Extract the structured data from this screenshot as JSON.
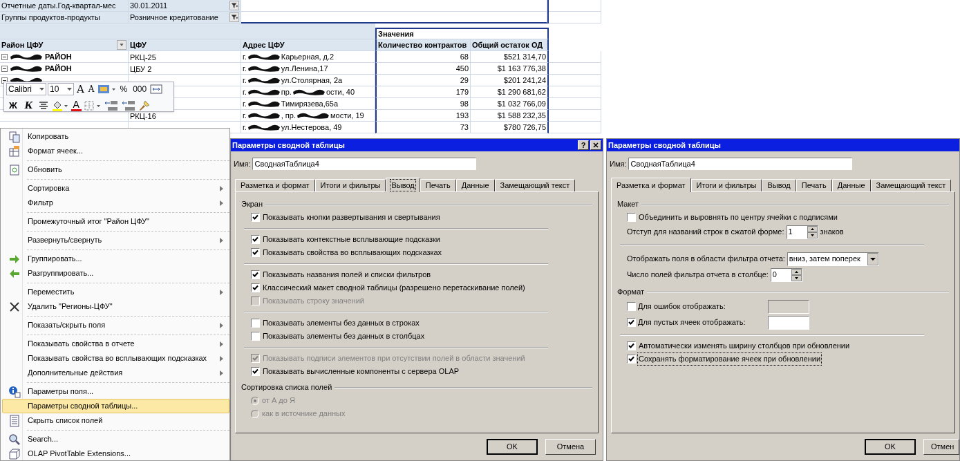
{
  "sheet": {
    "filters": [
      {
        "label": "Отчетные даты.Год-квартал-мес",
        "value": "30.01.2011"
      },
      {
        "label": "Группы продуктов-продукты",
        "value": "Розничное кредитование"
      }
    ],
    "values_header": "Значения",
    "columns": [
      "Район ЦФУ",
      "ЦФУ",
      "Адрес ЦФУ",
      "Количество контрактов",
      "Общий остаток ОД"
    ],
    "rows": [
      {
        "region": [
          {
            "kind": "redaction"
          },
          {
            "kind": "text",
            "text": "РАЙОН"
          }
        ],
        "cfu": "РКЦ-25",
        "address": [
          {
            "kind": "text",
            "text": "г."
          },
          {
            "kind": "redaction"
          },
          {
            "kind": "text",
            "text": "Карьерная, д.2"
          }
        ],
        "count": "68",
        "balance": "$521 314,70"
      },
      {
        "region": [
          {
            "kind": "redaction"
          },
          {
            "kind": "text",
            "text": "РАЙОН"
          }
        ],
        "cfu": "ЦБУ 2",
        "address": [
          {
            "kind": "text",
            "text": "г."
          },
          {
            "kind": "redaction"
          },
          {
            "kind": "text",
            "text": "ул.Ленина,17"
          }
        ],
        "count": "450",
        "balance": "$1 163 776,38"
      },
      {
        "region": [
          {
            "kind": "redaction"
          }
        ],
        "cfu": "",
        "address": [
          {
            "kind": "text",
            "text": "г."
          },
          {
            "kind": "redaction"
          },
          {
            "kind": "text",
            "text": "ул.Столярная, 2а"
          }
        ],
        "count": "29",
        "balance": "$201 241,24"
      },
      {
        "region": [],
        "cfu": "",
        "address": [
          {
            "kind": "text",
            "text": "г."
          },
          {
            "kind": "redaction"
          },
          {
            "kind": "text",
            "text": "пр."
          },
          {
            "kind": "redaction"
          },
          {
            "kind": "text",
            "text": "ости, 40"
          }
        ],
        "count": "179",
        "balance": "$1 290 681,62"
      },
      {
        "region": [],
        "cfu": "",
        "address": [
          {
            "kind": "text",
            "text": "г."
          },
          {
            "kind": "redaction"
          },
          {
            "kind": "text",
            "text": "Тимирязева,65а"
          }
        ],
        "count": "98",
        "balance": "$1 032 766,09"
      },
      {
        "region": [],
        "cfu": "РКЦ-16",
        "address": [
          {
            "kind": "text",
            "text": "г."
          },
          {
            "kind": "redaction"
          },
          {
            "kind": "text",
            "text": ", пр."
          },
          {
            "kind": "redaction"
          },
          {
            "kind": "text",
            "text": "мости, 19"
          }
        ],
        "count": "193",
        "balance": "$1 588 232,35"
      },
      {
        "region": [],
        "cfu": "",
        "address": [
          {
            "kind": "text",
            "text": "г."
          },
          {
            "kind": "redaction"
          },
          {
            "kind": "text",
            "text": "ул.Нестерова, 49"
          }
        ],
        "count": "73",
        "balance": "$780 726,75"
      }
    ]
  },
  "mini_toolbar": {
    "font": "Calibri",
    "size": "10",
    "row1": [
      {
        "kind": "grow",
        "label": "A"
      },
      {
        "kind": "shrink",
        "label": "A"
      },
      {
        "kind": "styles"
      },
      {
        "kind": "percent",
        "label": "%"
      },
      {
        "kind": "thousands",
        "label": "000"
      },
      {
        "kind": "merge"
      }
    ],
    "row2": [
      {
        "kind": "bold",
        "label": "Ж"
      },
      {
        "kind": "italic",
        "label": "К"
      },
      {
        "kind": "center"
      },
      {
        "kind": "fill"
      },
      {
        "kind": "fontcolor",
        "label": "A"
      },
      {
        "kind": "borders"
      },
      {
        "kind": "inc"
      },
      {
        "kind": "dec"
      },
      {
        "kind": "painter"
      }
    ]
  },
  "context_menu": {
    "groups": [
      [
        {
          "label": "Копировать",
          "kind": "copy",
          "submenu": false,
          "selected": false
        },
        {
          "label": "Формат ячеек...",
          "kind": "format",
          "submenu": false,
          "selected": false
        }
      ],
      [
        {
          "label": "Обновить",
          "kind": "refresh",
          "submenu": false,
          "selected": false
        }
      ],
      [
        {
          "label": "Сортировка",
          "kind": "plain",
          "submenu": true,
          "selected": false
        },
        {
          "label": "Фильтр",
          "kind": "plain",
          "submenu": true,
          "selected": false
        }
      ],
      [
        {
          "label": "Промежуточный итог \"Район ЦФУ\"",
          "kind": "plain",
          "submenu": false,
          "selected": false
        }
      ],
      [
        {
          "label": "Развернуть/свернуть",
          "kind": "plain",
          "submenu": true,
          "selected": false
        }
      ],
      [
        {
          "label": "Группировать...",
          "kind": "group",
          "submenu": false,
          "selected": false
        },
        {
          "label": "Разгруппировать...",
          "kind": "ungroup",
          "submenu": false,
          "selected": false
        }
      ],
      [
        {
          "label": "Переместить",
          "kind": "plain",
          "submenu": true,
          "selected": false
        },
        {
          "label": "Удалить \"Регионы-ЦФУ\"",
          "kind": "delete",
          "submenu": false,
          "selected": false
        }
      ],
      [
        {
          "label": "Показать/скрыть поля",
          "kind": "plain",
          "submenu": true,
          "selected": false
        }
      ],
      [
        {
          "label": "Показывать свойства в отчете",
          "kind": "plain",
          "submenu": true,
          "selected": false
        },
        {
          "label": "Показывать свойства во всплывающих подсказках",
          "kind": "plain",
          "submenu": true,
          "selected": false
        },
        {
          "label": "Дополнительные действия",
          "kind": "plain",
          "submenu": true,
          "selected": false
        }
      ],
      [
        {
          "label": "Параметры поля...",
          "kind": "info",
          "submenu": false,
          "selected": false
        },
        {
          "label": "Параметры сводной таблицы...",
          "kind": "plain",
          "submenu": false,
          "selected": true
        },
        {
          "label": "Скрыть список полей",
          "kind": "list",
          "submenu": false,
          "selected": false
        }
      ],
      [
        {
          "label": "Search...",
          "kind": "search",
          "submenu": false,
          "selected": false
        },
        {
          "label": "OLAP PivotTable Extensions...",
          "kind": "cube",
          "submenu": false,
          "selected": false
        }
      ]
    ]
  },
  "dialogs": [
    {
      "title": "Параметры сводной таблицы",
      "help": "?",
      "name_label": "Имя:",
      "name": "СводнаяТаблица4",
      "tabs": [
        {
          "label": "Разметка и формат",
          "selected": false
        },
        {
          "label": "Итоги и фильтры",
          "selected": false
        },
        {
          "label": "Вывод",
          "selected": true
        },
        {
          "label": "Печать",
          "selected": false
        },
        {
          "label": "Данные",
          "selected": false
        },
        {
          "label": "Замещающий текст",
          "selected": false
        }
      ],
      "rows": [
        {
          "kind": "section",
          "label": "Экран"
        },
        {
          "kind": "checkbox",
          "label": "Показывать кнопки развертывания и свертывания",
          "checked": true,
          "disabled": false
        },
        {
          "kind": "divider"
        },
        {
          "kind": "checkbox",
          "label": "Показывать контекстные всплывающие подсказки",
          "checked": true,
          "disabled": false
        },
        {
          "kind": "checkbox",
          "label": "Показывать свойства во всплывающих подсказках",
          "checked": true,
          "disabled": false
        },
        {
          "kind": "divider"
        },
        {
          "kind": "checkbox",
          "label": "Показывать названия полей и списки фильтров",
          "checked": true,
          "disabled": false
        },
        {
          "kind": "checkbox",
          "label": "Классический макет сводной таблицы (разрешено перетаскивание полей)",
          "checked": true,
          "disabled": false
        },
        {
          "kind": "checkbox",
          "label": "Показывать строку значений",
          "checked": false,
          "disabled": true
        },
        {
          "kind": "divider"
        },
        {
          "kind": "checkbox",
          "label": "Показывать элементы без данных в строках",
          "checked": false,
          "disabled": false
        },
        {
          "kind": "checkbox",
          "label": "Показывать элементы без данных в столбцах",
          "checked": false,
          "disabled": false
        },
        {
          "kind": "divider"
        },
        {
          "kind": "checkbox",
          "label": "Показывать подписи элементов при отсутствии полей в области значений",
          "checked": true,
          "disabled": true
        },
        {
          "kind": "checkbox",
          "label": "Показывать вычисленные компоненты с сервера OLAP",
          "checked": true,
          "disabled": false
        },
        {
          "kind": "section",
          "label": "Сортировка списка полей"
        },
        {
          "kind": "radio",
          "label": "от А до Я",
          "selected": true,
          "disabled": true
        },
        {
          "kind": "radio",
          "label": "как в источнике данных",
          "selected": false,
          "disabled": true
        }
      ],
      "ok": "OK",
      "cancel": "Отмена"
    },
    {
      "title": "Параметры сводной таблицы",
      "name_label": "Имя:",
      "name": "СводнаяТаблица4",
      "tabs": [
        {
          "label": "Разметка и формат",
          "selected": true
        },
        {
          "label": "Итоги и фильтры",
          "selected": false
        },
        {
          "label": "Вывод",
          "selected": false
        },
        {
          "label": "Печать",
          "selected": false
        },
        {
          "label": "Данные",
          "selected": false
        },
        {
          "label": "Замещающий текст",
          "selected": false
        }
      ],
      "rows": [
        {
          "kind": "section",
          "label": "Макет"
        },
        {
          "kind": "checkbox",
          "label": "Объединить и выровнять по центру ячейки с подписями",
          "checked": false,
          "disabled": false
        },
        {
          "kind": "spinner",
          "label": "Отступ для названий строк в сжатой форме:",
          "value": "1",
          "suffix": "знаков"
        },
        {
          "kind": "divider"
        },
        {
          "kind": "select",
          "label": "Отображать поля в области фильтра отчета:",
          "value": "вниз, затем поперек"
        },
        {
          "kind": "spinner",
          "label": "Число полей фильтра отчета в столбце:",
          "value": "0"
        },
        {
          "kind": "section",
          "label": "Формат"
        },
        {
          "kind": "checkbox_field",
          "label": "Для ошибок отображать:",
          "checked": false,
          "disabled": true
        },
        {
          "kind": "checkbox_field",
          "label": "Для пустых ячеек отображать:",
          "checked": true,
          "disabled": false
        },
        {
          "kind": "divider"
        },
        {
          "kind": "checkbox",
          "label": "Автоматически изменять ширину столбцов при обновлении",
          "checked": true,
          "disabled": false
        },
        {
          "kind": "checkbox",
          "label": "Сохранять форматирование ячеек при обновлении",
          "checked": true,
          "disabled": false,
          "focused": true
        }
      ],
      "ok": "OK",
      "cancel": "Отмен"
    }
  ]
}
